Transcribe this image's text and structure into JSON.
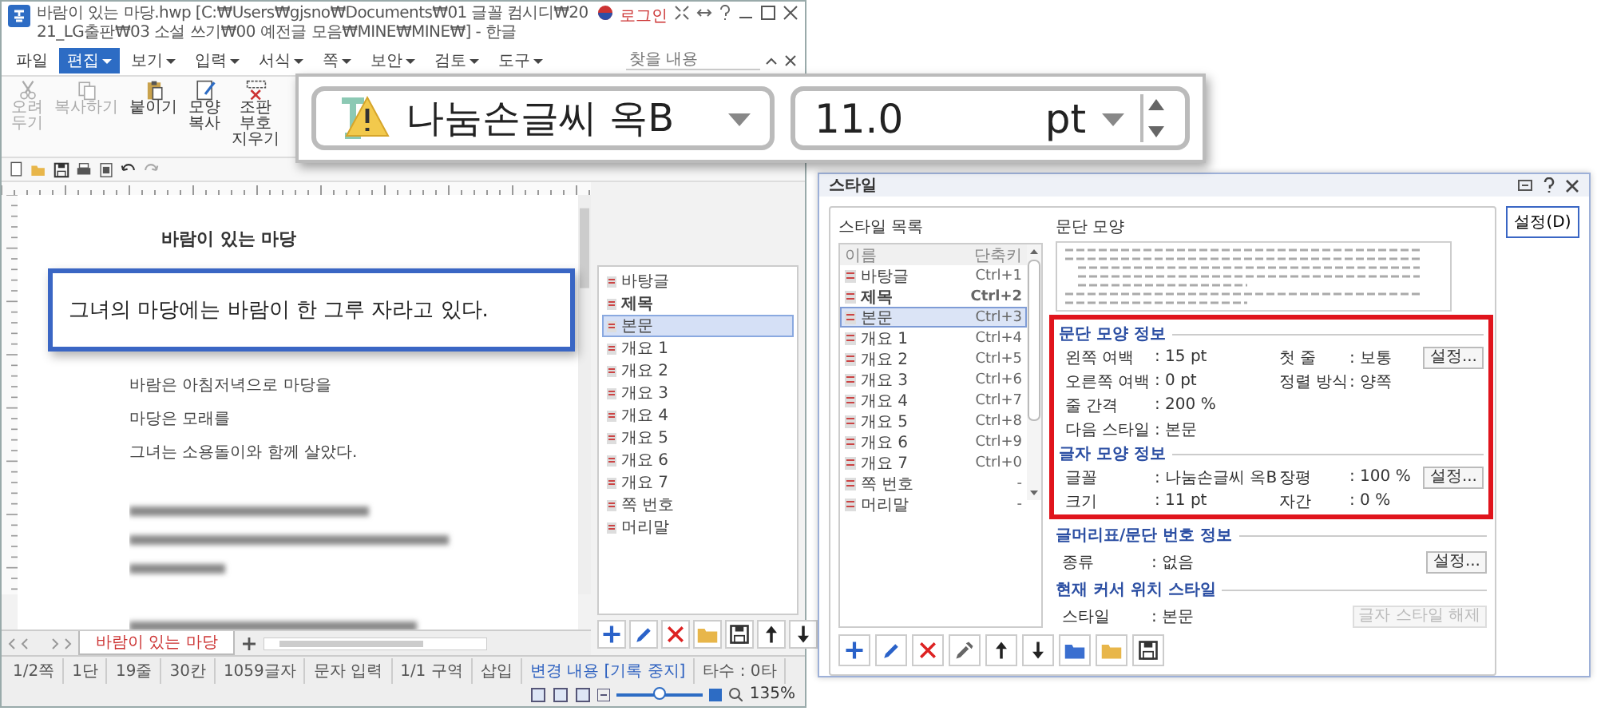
{
  "editor": {
    "title": "바람이 있는 마당.hwp [C:₩Users₩gjsno₩Documents₩01 글꼴 컴시디₩2021_LG출판₩03 소설 쓰기₩00 예전글 모음₩MINE₩MINE₩] - 한글",
    "login": "로그인",
    "menus": [
      {
        "label": "파일",
        "selected": false,
        "dropdown": false
      },
      {
        "label": "편집",
        "selected": true,
        "dropdown": true
      },
      {
        "label": "보기",
        "selected": false,
        "dropdown": true
      },
      {
        "label": "입력",
        "selected": false,
        "dropdown": true
      },
      {
        "label": "서식",
        "selected": false,
        "dropdown": true
      },
      {
        "label": "쪽",
        "selected": false,
        "dropdown": true
      },
      {
        "label": "보안",
        "selected": false,
        "dropdown": true
      },
      {
        "label": "검토",
        "selected": false,
        "dropdown": true
      },
      {
        "label": "도구",
        "selected": false,
        "dropdown": true
      }
    ],
    "search": {
      "placeholder": "찾을 내용"
    },
    "ribbon": [
      {
        "label": "오려 두기",
        "kind": "cut",
        "disabled": true
      },
      {
        "label": "복사하기",
        "kind": "copy",
        "disabled": true
      },
      {
        "label": "붙이기",
        "kind": "paste",
        "disabled": false
      },
      {
        "label": "모양 복사",
        "kind": "format",
        "disabled": false
      },
      {
        "label": "조판 부호 지우기",
        "kind": "clear",
        "disabled": false
      }
    ],
    "document": {
      "title": "바람이 있는 마당",
      "lines": [
        "바람은 아침저녁으로 마당을",
        "마당은 모래를",
        "그녀는 소용돌이와 함께 살았다."
      ]
    },
    "styles": [
      {
        "name": "바탕글",
        "bold": false,
        "selected": false
      },
      {
        "name": "제목",
        "bold": true,
        "selected": false
      },
      {
        "name": "본문",
        "bold": false,
        "selected": true
      },
      {
        "name": "개요 1",
        "bold": false,
        "selected": false
      },
      {
        "name": "개요 2",
        "bold": false,
        "selected": false
      },
      {
        "name": "개요 3",
        "bold": false,
        "selected": false
      },
      {
        "name": "개요 4",
        "bold": false,
        "selected": false
      },
      {
        "name": "개요 5",
        "bold": false,
        "selected": false
      },
      {
        "name": "개요 6",
        "bold": false,
        "selected": false
      },
      {
        "name": "개요 7",
        "bold": false,
        "selected": false
      },
      {
        "name": "쪽 번호",
        "bold": false,
        "selected": false
      },
      {
        "name": "머리말",
        "bold": false,
        "selected": false
      }
    ],
    "sheet_tab": {
      "label": "바람이 있는 마당",
      "selected": true
    },
    "status": [
      {
        "text": "1/2쪽",
        "kind": "plain"
      },
      {
        "text": "1단",
        "kind": "plain"
      },
      {
        "text": "19줄",
        "kind": "plain"
      },
      {
        "text": "30칸",
        "kind": "plain"
      },
      {
        "text": "1059글자",
        "kind": "plain"
      },
      {
        "text": "문자 입력",
        "kind": "plain"
      },
      {
        "text": "1/1 구역",
        "kind": "plain"
      },
      {
        "text": "삽입",
        "kind": "plain"
      },
      {
        "text": "변경 내용 [기록 중지]",
        "kind": "link"
      },
      {
        "text": "타수 : 0타",
        "kind": "plain"
      }
    ],
    "zoom": {
      "level": 0.5,
      "reading": "135%"
    }
  },
  "font_callout": {
    "font": "나눔손글씨 옥B",
    "size": "11.0",
    "unit": "pt"
  },
  "text_callout": "그녀의 마당에는 바람이 한 그루 자라고 있다.",
  "dialog": {
    "title": "스타일",
    "list_title": "스타일 목록",
    "columns": [
      "이름",
      "단축키"
    ],
    "rows": [
      {
        "name": "바탕글",
        "shortcut": "Ctrl+1",
        "bold": false,
        "selected": false
      },
      {
        "name": "제목",
        "shortcut": "Ctrl+2",
        "bold": true,
        "selected": false
      },
      {
        "name": "본문",
        "shortcut": "Ctrl+3",
        "bold": false,
        "selected": true
      },
      {
        "name": "개요 1",
        "shortcut": "Ctrl+4",
        "bold": false,
        "selected": false
      },
      {
        "name": "개요 2",
        "shortcut": "Ctrl+5",
        "bold": false,
        "selected": false
      },
      {
        "name": "개요 3",
        "shortcut": "Ctrl+6",
        "bold": false,
        "selected": false
      },
      {
        "name": "개요 4",
        "shortcut": "Ctrl+7",
        "bold": false,
        "selected": false
      },
      {
        "name": "개요 5",
        "shortcut": "Ctrl+8",
        "bold": false,
        "selected": false
      },
      {
        "name": "개요 6",
        "shortcut": "Ctrl+9",
        "bold": false,
        "selected": false
      },
      {
        "name": "개요 7",
        "shortcut": "Ctrl+0",
        "bold": false,
        "selected": false
      },
      {
        "name": "쪽 번호",
        "shortcut": "-",
        "bold": false,
        "selected": false
      },
      {
        "name": "머리말",
        "shortcut": "-",
        "bold": false,
        "selected": false
      }
    ],
    "preview_title": "문단 모양",
    "sections": [
      {
        "title": "문단 모양 정보",
        "highlighted": true,
        "rows": [
          {
            "fields": [
              {
                "label": "왼쪽 여백",
                "value": ": 15 pt"
              },
              {
                "label": "첫 줄",
                "value": ": 보통"
              }
            ],
            "button": {
              "label": "설정...",
              "disabled": false
            }
          },
          {
            "fields": [
              {
                "label": "오른쪽 여백",
                "value": ": 0 pt"
              },
              {
                "label": "정렬 방식",
                "value": ": 양쪽"
              }
            ]
          },
          {
            "fields": [
              {
                "label": "줄 간격",
                "value": ": 200 %"
              }
            ]
          },
          {
            "fields": [
              {
                "label": "다음 스타일",
                "value": ": 본문"
              }
            ]
          }
        ]
      },
      {
        "title": "글자 모양 정보",
        "highlighted": true,
        "rows": [
          {
            "fields": [
              {
                "label": "글꼴",
                "value": ": 나눔손글씨 옥B"
              },
              {
                "label": "장평",
                "value": ": 100 %"
              }
            ],
            "button": {
              "label": "설정...",
              "disabled": false
            }
          },
          {
            "fields": [
              {
                "label": "크기",
                "value": ": 11 pt"
              },
              {
                "label": "자간",
                "value": ": 0 %"
              }
            ]
          }
        ]
      },
      {
        "title": "글머리표/문단 번호 정보",
        "highlighted": false,
        "rows": [
          {
            "fields": [
              {
                "label": "종류",
                "value": ": 없음"
              }
            ],
            "button": {
              "label": "설정...",
              "disabled": false
            }
          }
        ]
      },
      {
        "title": "현재 커서 위치 스타일",
        "highlighted": false,
        "rows": [
          {
            "fields": [
              {
                "label": "스타일",
                "value": ": 본문"
              }
            ],
            "button": {
              "label": "글자 스타일 해제",
              "disabled": true
            }
          }
        ]
      }
    ],
    "action": "설정(D)"
  }
}
